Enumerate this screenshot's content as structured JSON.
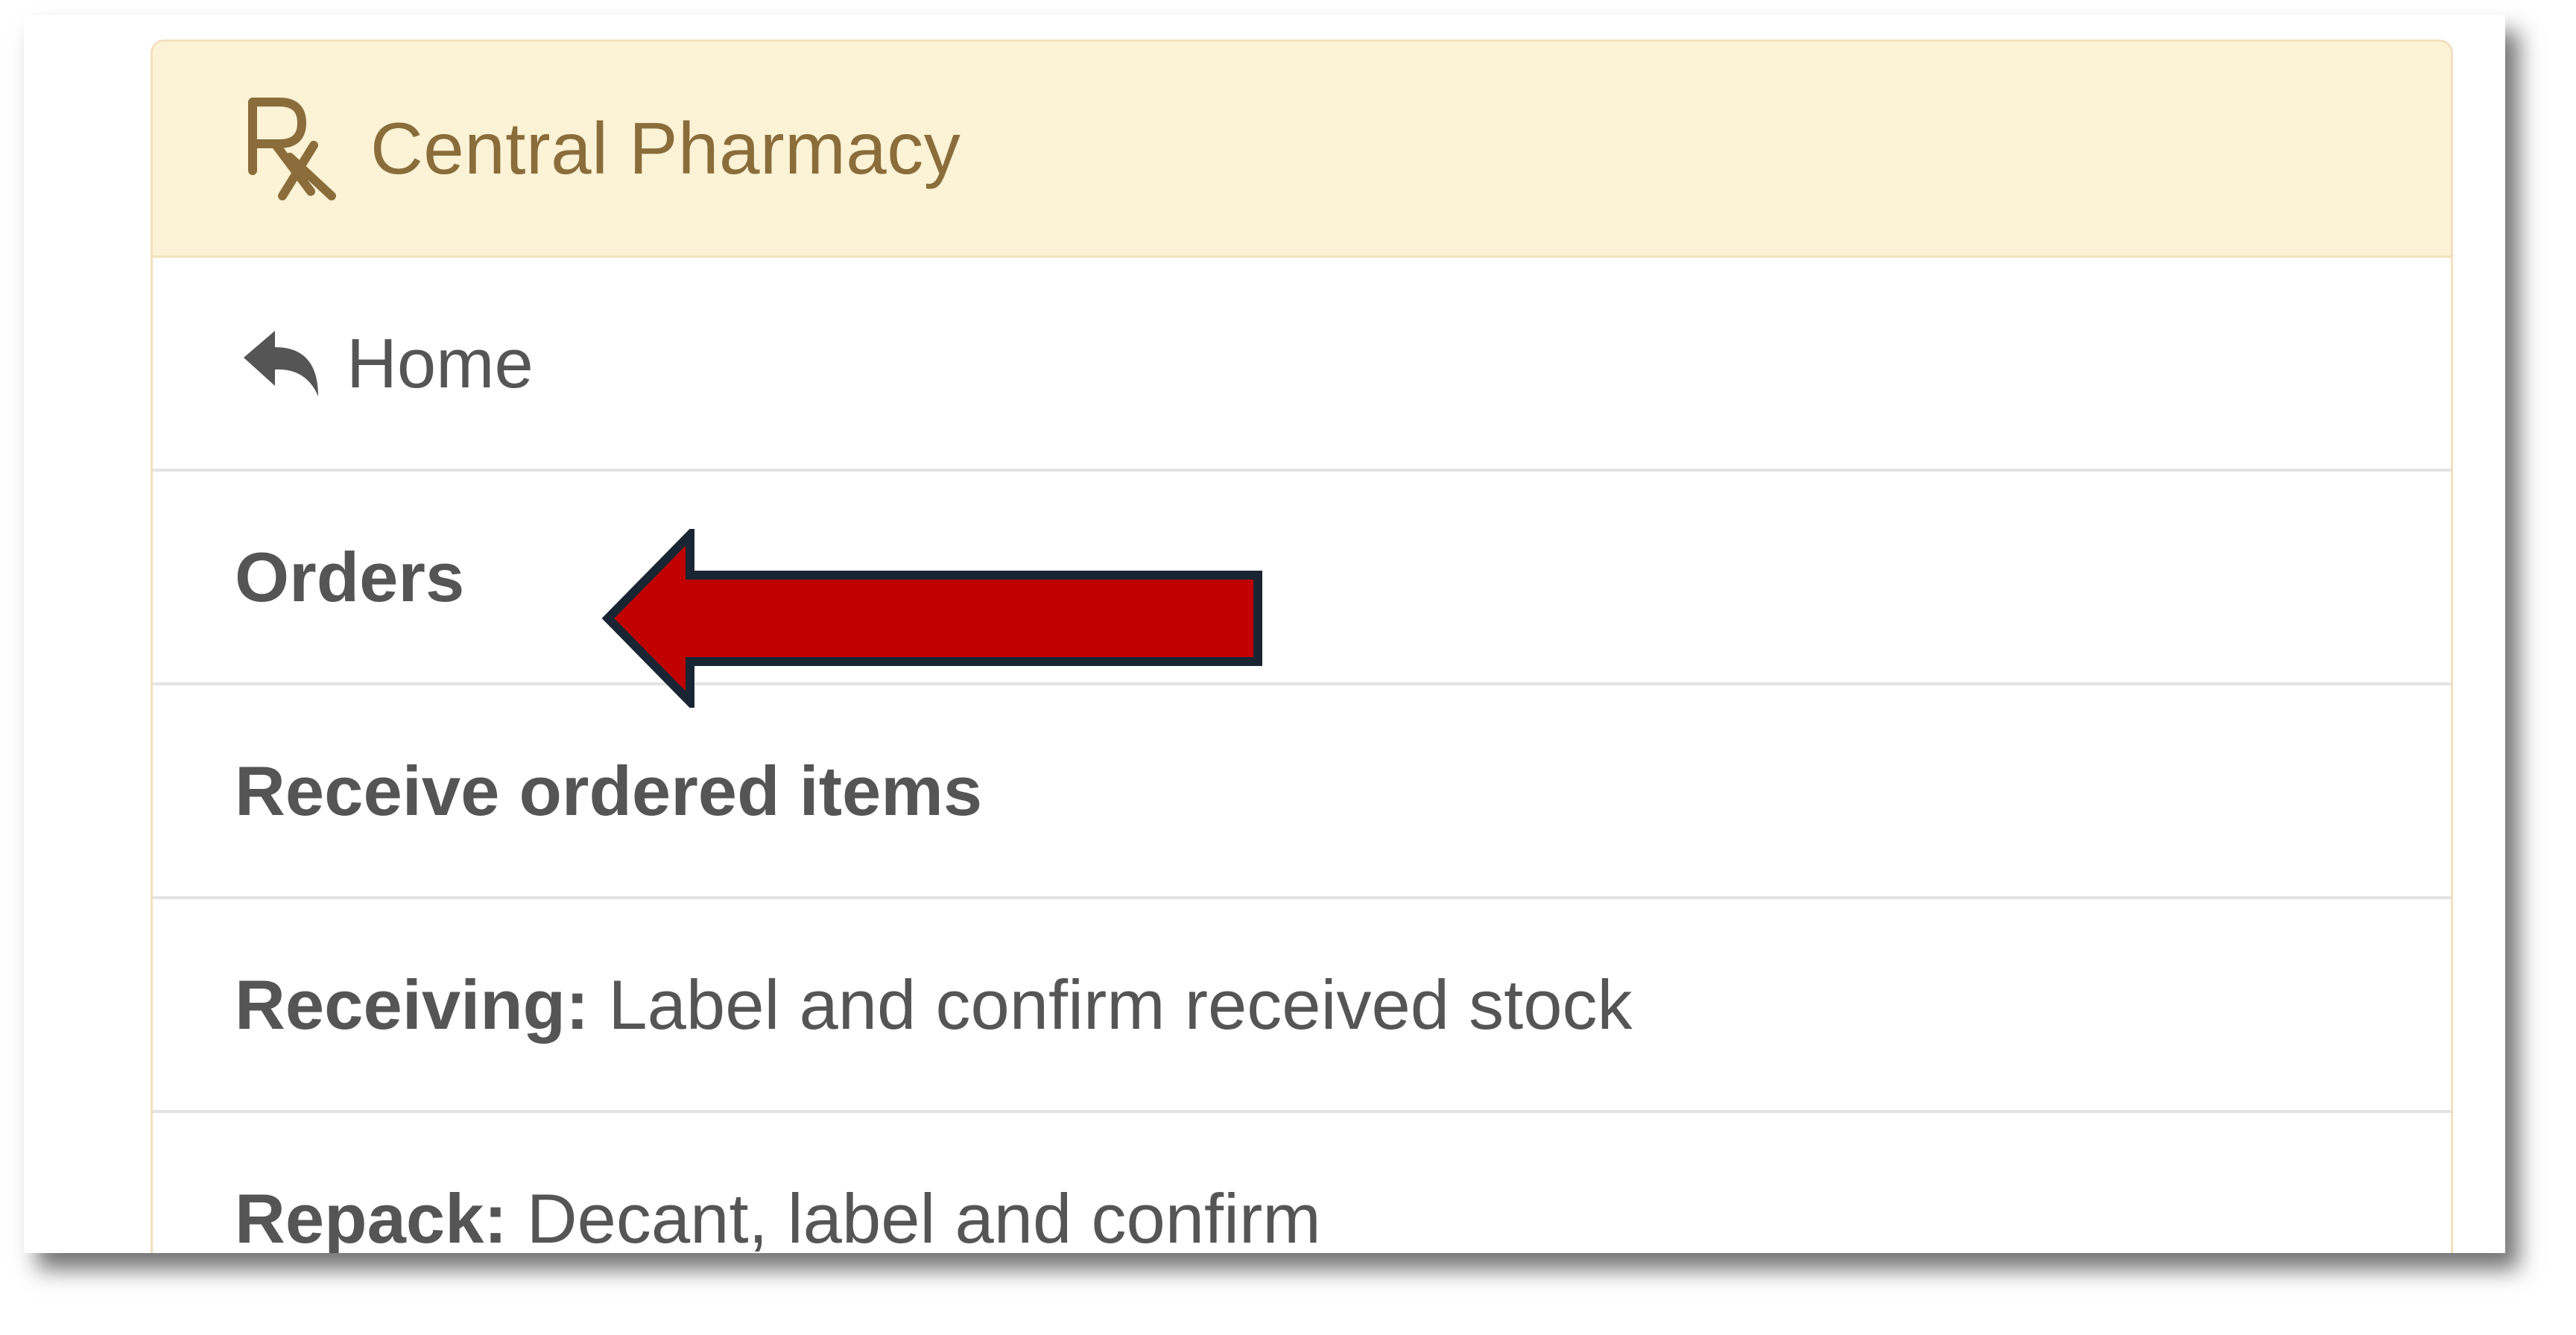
{
  "panel": {
    "title": "Central Pharmacy",
    "title_icon": "rx-icon",
    "heading_color": "#8a6d3b",
    "heading_bg": "#fcf3d6"
  },
  "menu": {
    "home": {
      "icon": "reply-arrow-icon",
      "label": "Home"
    },
    "items": [
      {
        "strong": "Orders",
        "text": ""
      },
      {
        "strong": "Receive ordered items",
        "text": ""
      },
      {
        "strong": "Receiving:",
        "text": "Label and confirm received stock"
      },
      {
        "strong": "Repack:",
        "text": "Decant, label and confirm"
      }
    ]
  },
  "annotation": {
    "icon": "pointer-arrow-icon",
    "color": "#c00000",
    "outline_color": "#1a2533"
  }
}
